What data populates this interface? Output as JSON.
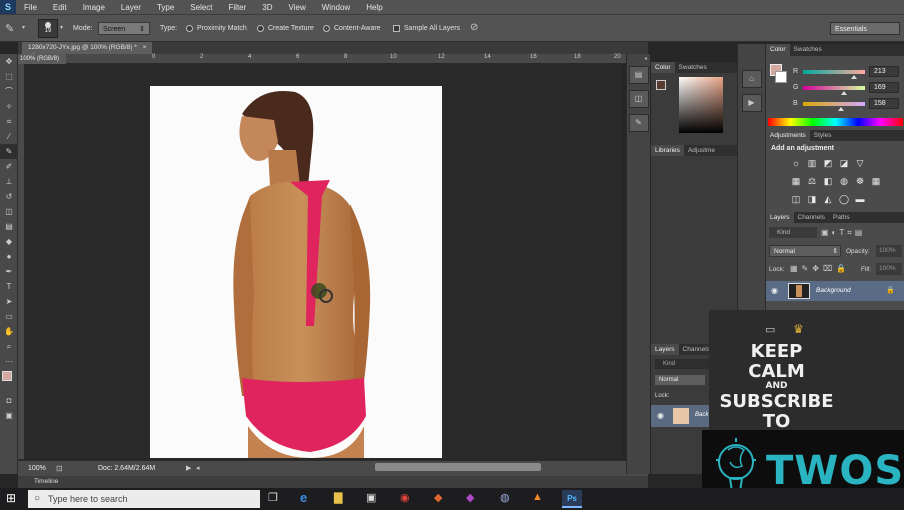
{
  "app": {
    "logo_letter": "S",
    "menu": [
      "File",
      "Edit",
      "Image",
      "Layer",
      "Type",
      "Select",
      "Filter",
      "3D",
      "View",
      "Window",
      "Help"
    ]
  },
  "options": {
    "brush_size": "19",
    "mode_label": "Mode:",
    "mode_value": "Screen",
    "type_label": "Type:",
    "radio_proximity": "Proximity Match",
    "radio_texture": "Create Texture",
    "radio_content": "Content-Aware",
    "sample_all": "Sample All Layers",
    "workspace": "Essentials"
  },
  "document": {
    "tab_title": "1280x720-JYx.jpg @ 100% (RGB/8) *",
    "tab_title_short": "100% (RGB/8)",
    "ruler_ticks": [
      "2",
      "0",
      "2",
      "4",
      "6",
      "8",
      "10",
      "12",
      "14",
      "16",
      "18",
      "20",
      "22"
    ],
    "zoom": "100%",
    "doc_size": "Doc: 2.64M/2.64M",
    "timeline_label": "Timeline"
  },
  "mid_panel": {
    "tabs_top": [
      "Color",
      "Swatches"
    ],
    "tabs_mid": [
      "Libraries",
      "Adjustme"
    ],
    "tabs_layers": [
      "Layers",
      "Channels"
    ],
    "kind": "Kind",
    "blend": "Normal",
    "lock_label": "Lock:",
    "layer_name": "Back"
  },
  "right_panel": {
    "color_tabs": [
      "Color",
      "Swatches"
    ],
    "r_label": "R",
    "r_value": "213",
    "g_label": "G",
    "g_value": "169",
    "b_label": "B",
    "b_value": "158",
    "adj_tabs": [
      "Adjustments",
      "Styles"
    ],
    "add_adjustment": "Add an adjustment",
    "layers_tabs": [
      "Layers",
      "Channels",
      "Paths"
    ],
    "kind": "Kind",
    "blend_mode": "Normal",
    "opacity_label": "Opacity:",
    "opacity_value": "100%",
    "lock_label": "Lock:",
    "fill_label": "Fill:",
    "fill_value": "100%",
    "layer_name": "Background"
  },
  "overlay": {
    "keep": "KEEP",
    "calm": "CALM",
    "and": "AND",
    "subscribe": "SUBSCRIBE",
    "to": "TO",
    "brand": "TWOS"
  },
  "taskbar": {
    "search_placeholder": "Type here to search"
  },
  "colors": {
    "foreground": "#d5a99e",
    "accent_brand": "#2ab3c1",
    "bikini": "#e0245e"
  }
}
